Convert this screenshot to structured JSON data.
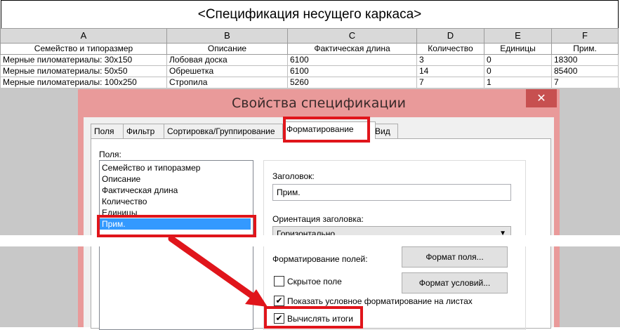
{
  "schedule": {
    "title": "<Спецификация несущего каркаса>",
    "column_letters": [
      "A",
      "B",
      "C",
      "D",
      "E",
      "F"
    ],
    "headers": [
      "Семейство и типоразмер",
      "Описание",
      "Фактическая длина",
      "Количество",
      "Единицы",
      "Прим."
    ],
    "rows": [
      [
        "Мерные пиломатериалы: 30x150",
        "Лобовая доска",
        "6100",
        "3",
        "0",
        "18300"
      ],
      [
        "Мерные пиломатериалы: 50x50",
        "Обрешетка",
        "6100",
        "14",
        "0",
        "85400"
      ],
      [
        "Мерные пиломатериалы: 100x250",
        "Стропила",
        "5260",
        "7",
        "1",
        "7"
      ]
    ]
  },
  "dialog": {
    "title": "Свойства спецификации",
    "close_glyph": "✕",
    "tabs": [
      "Поля",
      "Фильтр",
      "Сортировка/Группирование",
      "Форматирование",
      "Вид"
    ],
    "active_tab": "Форматирование",
    "fields_label": "Поля:",
    "fields": [
      "Семейство и типоразмер",
      "Описание",
      "Фактическая длина",
      "Количество",
      "Единицы",
      "Прим."
    ],
    "selected_field": "Прим.",
    "heading_label": "Заголовок:",
    "heading_value": "Прим.",
    "orientation_label": "Ориентация заголовка:",
    "orientation_value": "Горизонтально",
    "field_format_label": "Форматирование полей:",
    "field_format_button": "Формат поля...",
    "hidden_field_label": "Скрытое поле",
    "hidden_field_checked": false,
    "conditional_format_button": "Формат условий...",
    "show_conditional_label": "Показать условное форматирование на листах",
    "show_conditional_checked": true,
    "calc_totals_label": "Вычислять итоги",
    "calc_totals_checked": true,
    "check_glyph": "✔"
  },
  "colors": {
    "highlight": "#e0151b",
    "dialog_frame": "#e99a9a",
    "selection": "#3399ff"
  }
}
